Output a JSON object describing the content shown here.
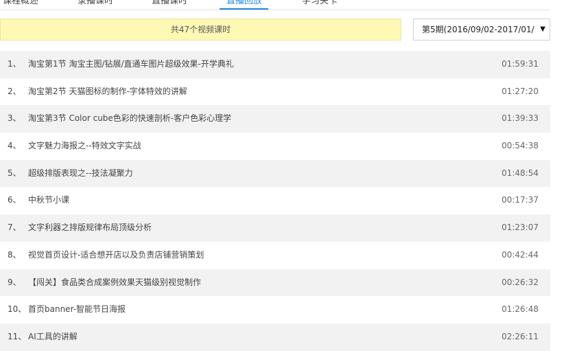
{
  "tabs": [
    {
      "label": "课程概述"
    },
    {
      "label": "录播课时"
    },
    {
      "label": "直播课时"
    },
    {
      "label": "直播回放"
    },
    {
      "label": "学习关卡"
    }
  ],
  "summary": "共47个视频课时",
  "period_select": {
    "selected": "第5期(2016/09/02-2017/01/",
    "arrow": "▼"
  },
  "lessons": [
    {
      "num": "1、",
      "title": "淘宝第1节 淘宝主图/钻展/直通车图片超级效果-开学典礼",
      "duration": "01:59:31"
    },
    {
      "num": "2、",
      "title": "淘宝第2节 天猫图标的制作-字体特效的讲解",
      "duration": "01:27:20"
    },
    {
      "num": "3、",
      "title": "淘宝第3节 Color cube色彩的快速剖析-客户色彩心理学",
      "duration": "01:39:33"
    },
    {
      "num": "4、",
      "title": "文字魅力海报之--特效文字实战",
      "duration": "00:54:38"
    },
    {
      "num": "5、",
      "title": "超级排版表现之--技法凝聚力",
      "duration": "01:48:54"
    },
    {
      "num": "6、",
      "title": "中秋节小课",
      "duration": "00:17:37"
    },
    {
      "num": "7、",
      "title": "文字利器之排版规律布局顶级分析",
      "duration": "01:23:07"
    },
    {
      "num": "8、",
      "title": "视觉首页设计-适合想开店以及负责店铺营销策划",
      "duration": "00:42:44"
    },
    {
      "num": "9、",
      "title": "【闯关】食品类合成案例效果天猫级别视觉制作",
      "duration": "00:26:32"
    },
    {
      "num": "10、",
      "title": "首页banner-智能节日海报",
      "duration": "01:26:48"
    },
    {
      "num": "11、",
      "title": "AI工具的讲解",
      "duration": "02:26:11"
    }
  ]
}
